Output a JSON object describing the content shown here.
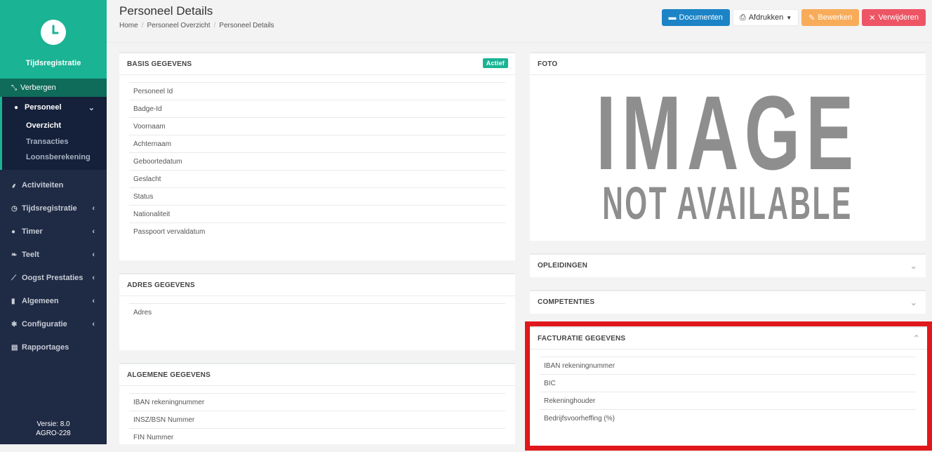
{
  "sidebar": {
    "brand": "Tijdsregistratie",
    "hide_label": "Verbergen",
    "open_menu": {
      "label": "Personeel",
      "items": [
        "Overzicht",
        "Transacties",
        "Loonsberekening"
      ]
    },
    "items": [
      {
        "label": "Activiteiten",
        "icon": "activity-icon"
      },
      {
        "label": "Tijdsregistratie",
        "icon": "clock-icon"
      },
      {
        "label": "Timer",
        "icon": "timer-icon"
      },
      {
        "label": "Teelt",
        "icon": "leaf-icon"
      },
      {
        "label": "Oogst Prestaties",
        "icon": "line-chart-icon"
      },
      {
        "label": "Algemeen",
        "icon": "bar-chart-icon"
      },
      {
        "label": "Configuratie",
        "icon": "gear-icon"
      },
      {
        "label": "Rapportages",
        "icon": "document-icon"
      }
    ],
    "version": "Versie: 8.0",
    "build": "AGRO-228"
  },
  "header": {
    "title": "Personeel Details",
    "breadcrumb": [
      "Home",
      "Personeel Overzicht",
      "Personeel Details"
    ],
    "buttons": {
      "documenten": "Documenten",
      "afdrukken": "Afdrukken",
      "bewerken": "Bewerken",
      "verwijderen": "Verwijderen"
    }
  },
  "panels": {
    "basis": {
      "title": "BASIS GEGEVENS",
      "badge": "Actief",
      "rows": [
        "Personeel Id",
        "Badge-Id",
        "Voornaam",
        "Achternaam",
        "Geboortedatum",
        "Geslacht",
        "Status",
        "Nationaliteit",
        "Passpoort vervaldatum"
      ]
    },
    "adres": {
      "title": "ADRES GEGEVENS",
      "rows": [
        "Adres"
      ]
    },
    "algemeen": {
      "title": "ALGEMENE GEGEVENS",
      "rows": [
        "IBAN rekeningnummer",
        "INSZ/BSN Nummer",
        "FIN Nummer"
      ]
    },
    "foto": {
      "title": "FOTO",
      "line1": "IMAGE",
      "line2": "NOT AVAILABLE"
    },
    "opleidingen": {
      "title": "OPLEIDINGEN"
    },
    "competenties": {
      "title": "COMPETENTIES"
    },
    "facturatie": {
      "title": "FACTURATIE GEGEVENS",
      "rows": [
        "IBAN rekeningnummer",
        "BIC",
        "Rekeninghouder",
        "Bedrijfsvoorheffing (%)"
      ]
    }
  }
}
